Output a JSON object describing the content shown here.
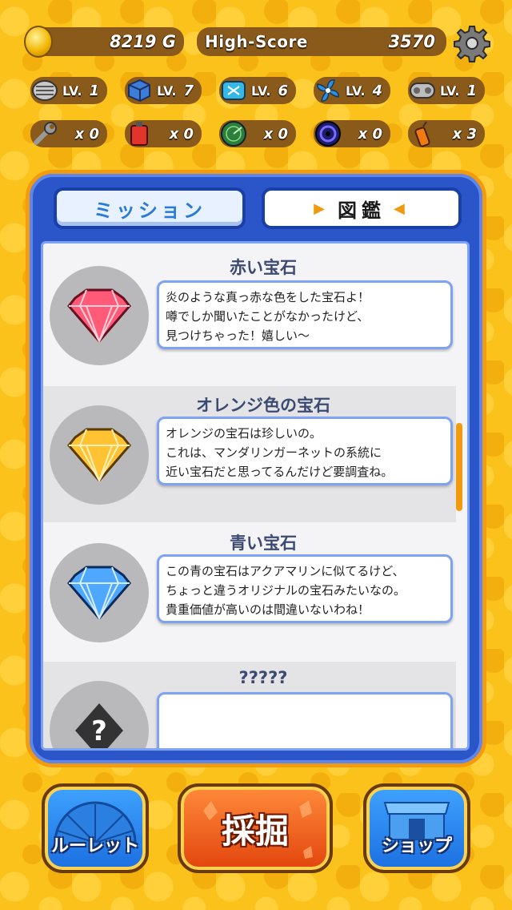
{
  "header": {
    "coins": "8219 G",
    "high_score_label": "High-Score",
    "high_score": "3570"
  },
  "upgrades": [
    {
      "icon": "drill-icon",
      "text": "LV. 1",
      "prefix": "LV.",
      "value": "1"
    },
    {
      "icon": "box-icon",
      "text": "LV. 7",
      "prefix": "LV.",
      "value": "7"
    },
    {
      "icon": "tank-icon",
      "text": "LV. 6",
      "prefix": "LV.",
      "value": "6"
    },
    {
      "icon": "fan-icon",
      "text": "LV. 4",
      "prefix": "LV.",
      "value": "4"
    },
    {
      "icon": "track-icon",
      "text": "LV. 1",
      "prefix": "LV.",
      "value": "1"
    }
  ],
  "items": [
    {
      "icon": "wrench-icon",
      "text": "x 0"
    },
    {
      "icon": "fuel-can-icon",
      "text": "x 0"
    },
    {
      "icon": "radar-icon",
      "text": "x 0"
    },
    {
      "icon": "vortex-icon",
      "text": "x 0"
    },
    {
      "icon": "dynamite-icon",
      "text": "x 3"
    }
  ],
  "tabs": {
    "mission": "ミッション",
    "zukan": "図鑑",
    "zukan_left": "▶",
    "zukan_right": "◀"
  },
  "entries": [
    {
      "title": "赤い宝石",
      "lines": [
        "炎のような真っ赤な色をした宝石よ！",
        "噂でしか聞いたことがなかったけど、",
        "見つけちゃった！嬉しい〜"
      ],
      "color": "#ff5a78"
    },
    {
      "title": "オレンジ色の宝石",
      "lines": [
        "オレンジの宝石は珍しいの。",
        "これは、マンダリンガーネットの系統に",
        "近い宝石だと思ってるんだけど要調査ね。"
      ],
      "color": "#ffc233"
    },
    {
      "title": "青い宝石",
      "lines": [
        "この青の宝石はアクアマリンに似てるけど、",
        "ちょっと違うオリジナルの宝石みたいなの。",
        "貴重価値が高いのは間違いないわね！"
      ],
      "color": "#4fa8ff"
    },
    {
      "title": "?????",
      "lines": [
        "",
        "",
        ""
      ],
      "color": "#333333"
    }
  ],
  "bottom": {
    "roulette": "ルーレット",
    "dig": "採掘",
    "shop": "ショップ"
  }
}
